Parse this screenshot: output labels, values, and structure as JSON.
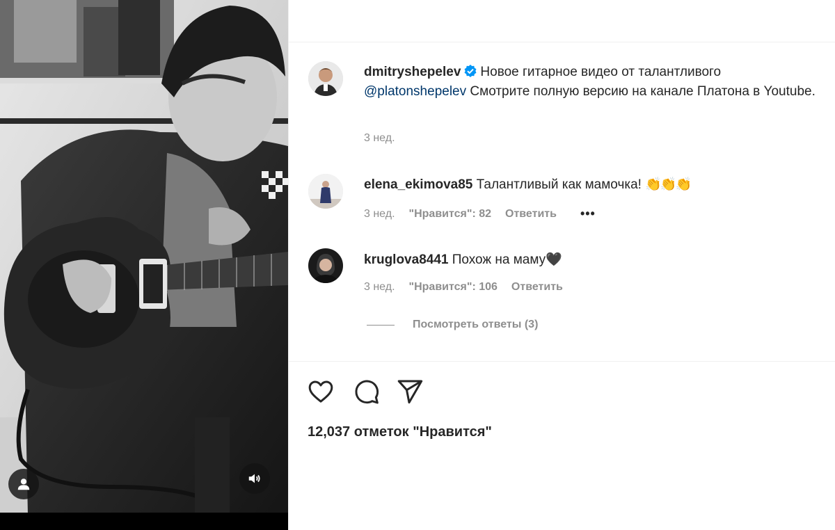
{
  "media": {
    "tag_icon": "person-tag-icon",
    "sound_icon": "speaker-icon"
  },
  "post": {
    "author": "dmitryshepelev",
    "verified_icon": "verified-badge-icon",
    "caption_part1": "Новое гитарное видео от талантливого",
    "mention": "@platonshepelev",
    "caption_part2": "Смотрите полную версию на канале Платона в Youtube.",
    "time": "3 нед."
  },
  "comments": [
    {
      "username": "elena_ekimova85",
      "text": "Талантливый как мамочка!",
      "emoji": "👏👏👏",
      "time": "3 нед.",
      "likes": "\"Нравится\": 82",
      "reply": "Ответить",
      "more": "•••"
    },
    {
      "username": "kruglova8441",
      "text": "Похож на маму",
      "emoji": "🖤",
      "time": "3 нед.",
      "likes": "\"Нравится\": 106",
      "reply": "Ответить"
    }
  ],
  "view_replies": "Посмотреть ответы (3)",
  "actions": {
    "like_icon": "heart-icon",
    "comment_icon": "comment-icon",
    "share_icon": "paper-plane-icon"
  },
  "likes_total": "12,037 отметок \"Нравится\"",
  "colors": {
    "text": "#262626",
    "secondary": "#8e8e8e",
    "mention": "#00376b",
    "verified": "#0095f6",
    "divider": "#efefef"
  }
}
